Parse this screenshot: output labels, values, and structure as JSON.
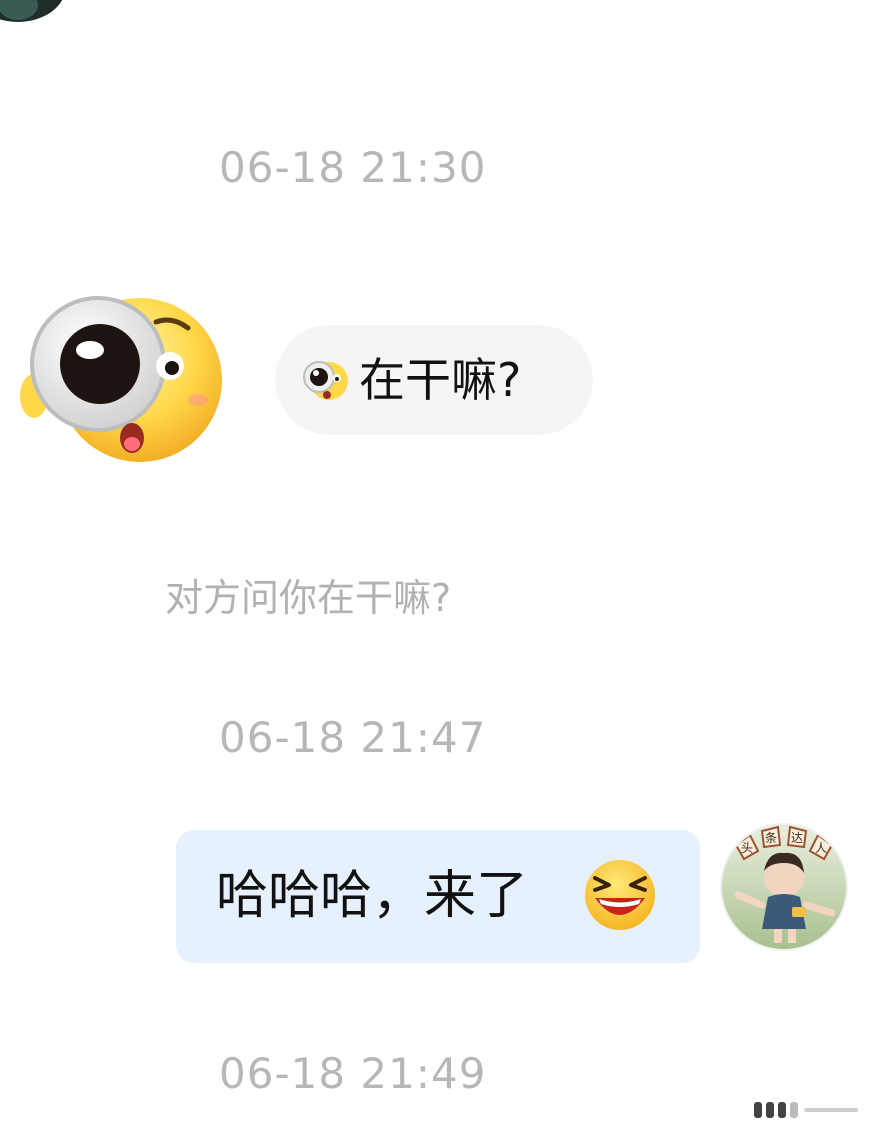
{
  "messages": {
    "ts1": "06-18 21:30",
    "incoming": {
      "text": "在干嘛?",
      "emoji": "peeking-eye-emoji"
    },
    "system_note": "对方问你在干嘛?",
    "ts2": "06-18 21:47",
    "outgoing": {
      "text": "哈哈哈，来了",
      "emoji": "laughing-emoji"
    },
    "ts3": "06-18 21:49"
  },
  "avatar_badge": {
    "chars": [
      "头",
      "条",
      "达",
      "人"
    ]
  },
  "colors": {
    "timestamp": "#b7b7b7",
    "incoming_bubble": "#f5f5f5",
    "outgoing_bubble": "#e7f1fd",
    "system_note": "#b1b1b1"
  }
}
